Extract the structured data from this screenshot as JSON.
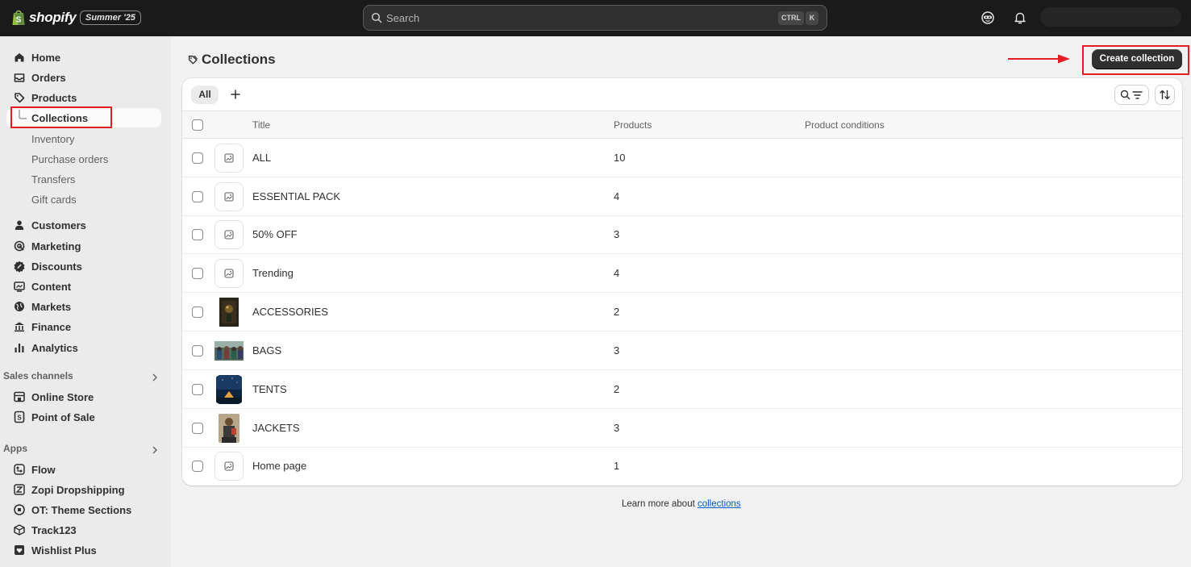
{
  "topbar": {
    "brand": "shopify",
    "edition": "Summer '25",
    "search_placeholder": "Search",
    "shortcut_ctrl": "CTRL",
    "shortcut_k": "K"
  },
  "sidebar": {
    "primary": [
      {
        "label": "Home",
        "icon": "home-icon"
      },
      {
        "label": "Orders",
        "icon": "inbox-icon"
      },
      {
        "label": "Products",
        "icon": "tag-icon"
      }
    ],
    "product_sub": [
      {
        "label": "Collections",
        "active": true
      },
      {
        "label": "Inventory"
      },
      {
        "label": "Purchase orders"
      },
      {
        "label": "Transfers"
      },
      {
        "label": "Gift cards"
      }
    ],
    "secondary": [
      {
        "label": "Customers",
        "icon": "person-icon"
      },
      {
        "label": "Marketing",
        "icon": "target-icon"
      },
      {
        "label": "Discounts",
        "icon": "discount-icon"
      },
      {
        "label": "Content",
        "icon": "content-icon"
      },
      {
        "label": "Markets",
        "icon": "globe-icon"
      },
      {
        "label": "Finance",
        "icon": "bank-icon"
      },
      {
        "label": "Analytics",
        "icon": "chart-icon"
      }
    ],
    "sales_channels_heading": "Sales channels",
    "sales_channels": [
      {
        "label": "Online Store",
        "icon": "store-icon"
      },
      {
        "label": "Point of Sale",
        "icon": "pos-icon"
      }
    ],
    "apps_heading": "Apps",
    "apps": [
      {
        "label": "Flow",
        "icon": "flow-icon"
      },
      {
        "label": "Zopi Dropshipping",
        "icon": "zopi-icon"
      },
      {
        "label": "OT: Theme Sections",
        "icon": "ot-icon"
      },
      {
        "label": "Track123",
        "icon": "box-icon"
      },
      {
        "label": "Wishlist Plus",
        "icon": "heart-icon"
      }
    ]
  },
  "page": {
    "title": "Collections",
    "create_button": "Create collection",
    "tab_all": "All"
  },
  "table": {
    "headers": {
      "title": "Title",
      "products": "Products",
      "conditions": "Product conditions"
    },
    "rows": [
      {
        "title": "ALL",
        "count": "10",
        "thumb": "placeholder"
      },
      {
        "title": "ESSENTIAL PACK",
        "count": "4",
        "thumb": "placeholder"
      },
      {
        "title": "50% OFF",
        "count": "3",
        "thumb": "placeholder"
      },
      {
        "title": "Trending",
        "count": "4",
        "thumb": "placeholder"
      },
      {
        "title": "ACCESSORIES",
        "count": "2",
        "thumb": "photo-accessories"
      },
      {
        "title": "BAGS",
        "count": "3",
        "thumb": "photo-bags"
      },
      {
        "title": "TENTS",
        "count": "2",
        "thumb": "photo-tents"
      },
      {
        "title": "JACKETS",
        "count": "3",
        "thumb": "photo-jackets"
      },
      {
        "title": "Home page",
        "count": "1",
        "thumb": "placeholder"
      }
    ]
  },
  "footer": {
    "prefix": "Learn more about ",
    "link": "collections"
  },
  "colors": {
    "topbar": "#1a1a1a",
    "primary_button": "#303030",
    "annotation": "#e51c23",
    "link": "#005bd3"
  }
}
